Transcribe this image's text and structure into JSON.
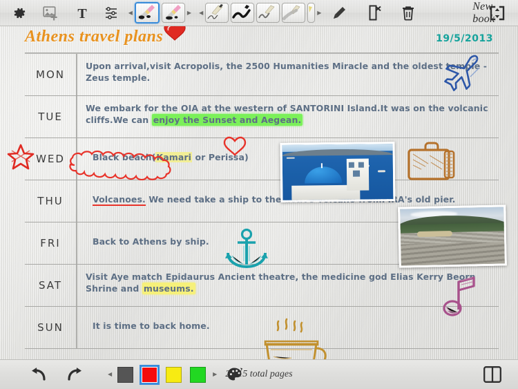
{
  "app": {
    "book_name": "New book",
    "page_indicator": "2 / 15 total pages"
  },
  "toolbar_top": {
    "items": [
      {
        "name": "settings-icon",
        "label": "Settings"
      },
      {
        "name": "add-image-icon",
        "label": "Insert image"
      },
      {
        "name": "text-tool-icon",
        "label": "Text"
      },
      {
        "name": "adjustments-icon",
        "label": "Adjustments"
      },
      {
        "name": "pen-style-1",
        "label": "Pen style 1",
        "selected": true
      },
      {
        "name": "pen-style-2",
        "label": "Pen style 2",
        "selected": false
      },
      {
        "name": "stroke-thin",
        "label": "Thin stroke",
        "selected": false
      },
      {
        "name": "stroke-bold",
        "label": "Bold stroke",
        "selected": false
      },
      {
        "name": "stroke-medium",
        "label": "Medium stroke",
        "selected": false
      },
      {
        "name": "stroke-brush",
        "label": "Brush stroke",
        "selected": false
      },
      {
        "name": "pencil-icon",
        "label": "Pencil"
      },
      {
        "name": "clear-page-icon",
        "label": "Clear page"
      },
      {
        "name": "trash-icon",
        "label": "Delete"
      },
      {
        "name": "fullscreen-icon",
        "label": "Expand"
      }
    ]
  },
  "page": {
    "title": "Athens travel plans",
    "date": "19/5/2013",
    "title_color": "#e8921f",
    "date_color": "#16a39c"
  },
  "schedule": {
    "rows": [
      {
        "day": "MON",
        "text_parts": [
          {
            "t": "Upon arrival,visit Acropolis, the 2500 Humanities Miracle and the oldest temple - Zeus temple.",
            "style": "plain"
          }
        ]
      },
      {
        "day": "TUE",
        "text_parts": [
          {
            "t": "We embark for the OIA at the western of SANTORINI Island.It was on the volcanic cliffs.We can ",
            "style": "plain"
          },
          {
            "t": "enjoy the Sunset and Aegean.",
            "style": "highlight-green"
          }
        ]
      },
      {
        "day": "WED",
        "text_parts": [
          {
            "t": "Black beach(",
            "style": "plain"
          },
          {
            "t": "Kamari",
            "style": "highlight-yellow-soft"
          },
          {
            "t": " or Perissa)",
            "style": "plain"
          }
        ]
      },
      {
        "day": "THU",
        "text_parts": [
          {
            "t": "Volcanoes.",
            "style": "underline-red"
          },
          {
            "t": " We need take a ship to the active volcano fromFIRA's old pier.",
            "style": "plain"
          }
        ]
      },
      {
        "day": "FRI",
        "text_parts": [
          {
            "t": "Back to Athens by ship.",
            "style": "plain"
          }
        ]
      },
      {
        "day": "SAT",
        "text_parts": [
          {
            "t": "Visit Aye match Epidaurus Ancient theatre, the medicine god Elias Kerry Beorn Shrine and ",
            "style": "plain"
          },
          {
            "t": "museums.",
            "style": "highlight-yellow"
          }
        ]
      },
      {
        "day": "SUN",
        "text_parts": [
          {
            "t": "It is time to back home.",
            "style": "plain"
          }
        ]
      }
    ]
  },
  "stickers": [
    {
      "name": "heart-sticker-title",
      "color": "#e02a22"
    },
    {
      "name": "airplane-sticker",
      "color": "#2d57a8"
    },
    {
      "name": "suitcase-sticker",
      "color": "#b5722c"
    },
    {
      "name": "anchor-sticker",
      "color": "#1aa2ad"
    },
    {
      "name": "music-note-sticker",
      "color": "#a8528c"
    },
    {
      "name": "coffee-cup-sticker",
      "color": "#c2912f"
    },
    {
      "name": "star-sticker",
      "color": "#e02a22"
    },
    {
      "name": "heart-sticker-wed",
      "color": "#e02a22"
    },
    {
      "name": "cloud-outline-annotation",
      "color": "#e8332a"
    }
  ],
  "photos": [
    {
      "name": "photo-santorini",
      "caption": "Santorini blue dome church"
    },
    {
      "name": "photo-epidaurus",
      "caption": "Epidaurus ancient theatre"
    }
  ],
  "toolbar_bottom": {
    "undo": "Undo",
    "redo": "Redo",
    "colors": [
      {
        "name": "color-swatch-gray",
        "hex": "#555555",
        "selected": false
      },
      {
        "name": "color-swatch-red",
        "hex": "#f40b0b",
        "selected": true
      },
      {
        "name": "color-swatch-yellow",
        "hex": "#f7eb12",
        "selected": false
      },
      {
        "name": "color-swatch-green",
        "hex": "#22d822",
        "selected": false
      }
    ],
    "palette_label": "Palette",
    "book_view_label": "Book view"
  }
}
